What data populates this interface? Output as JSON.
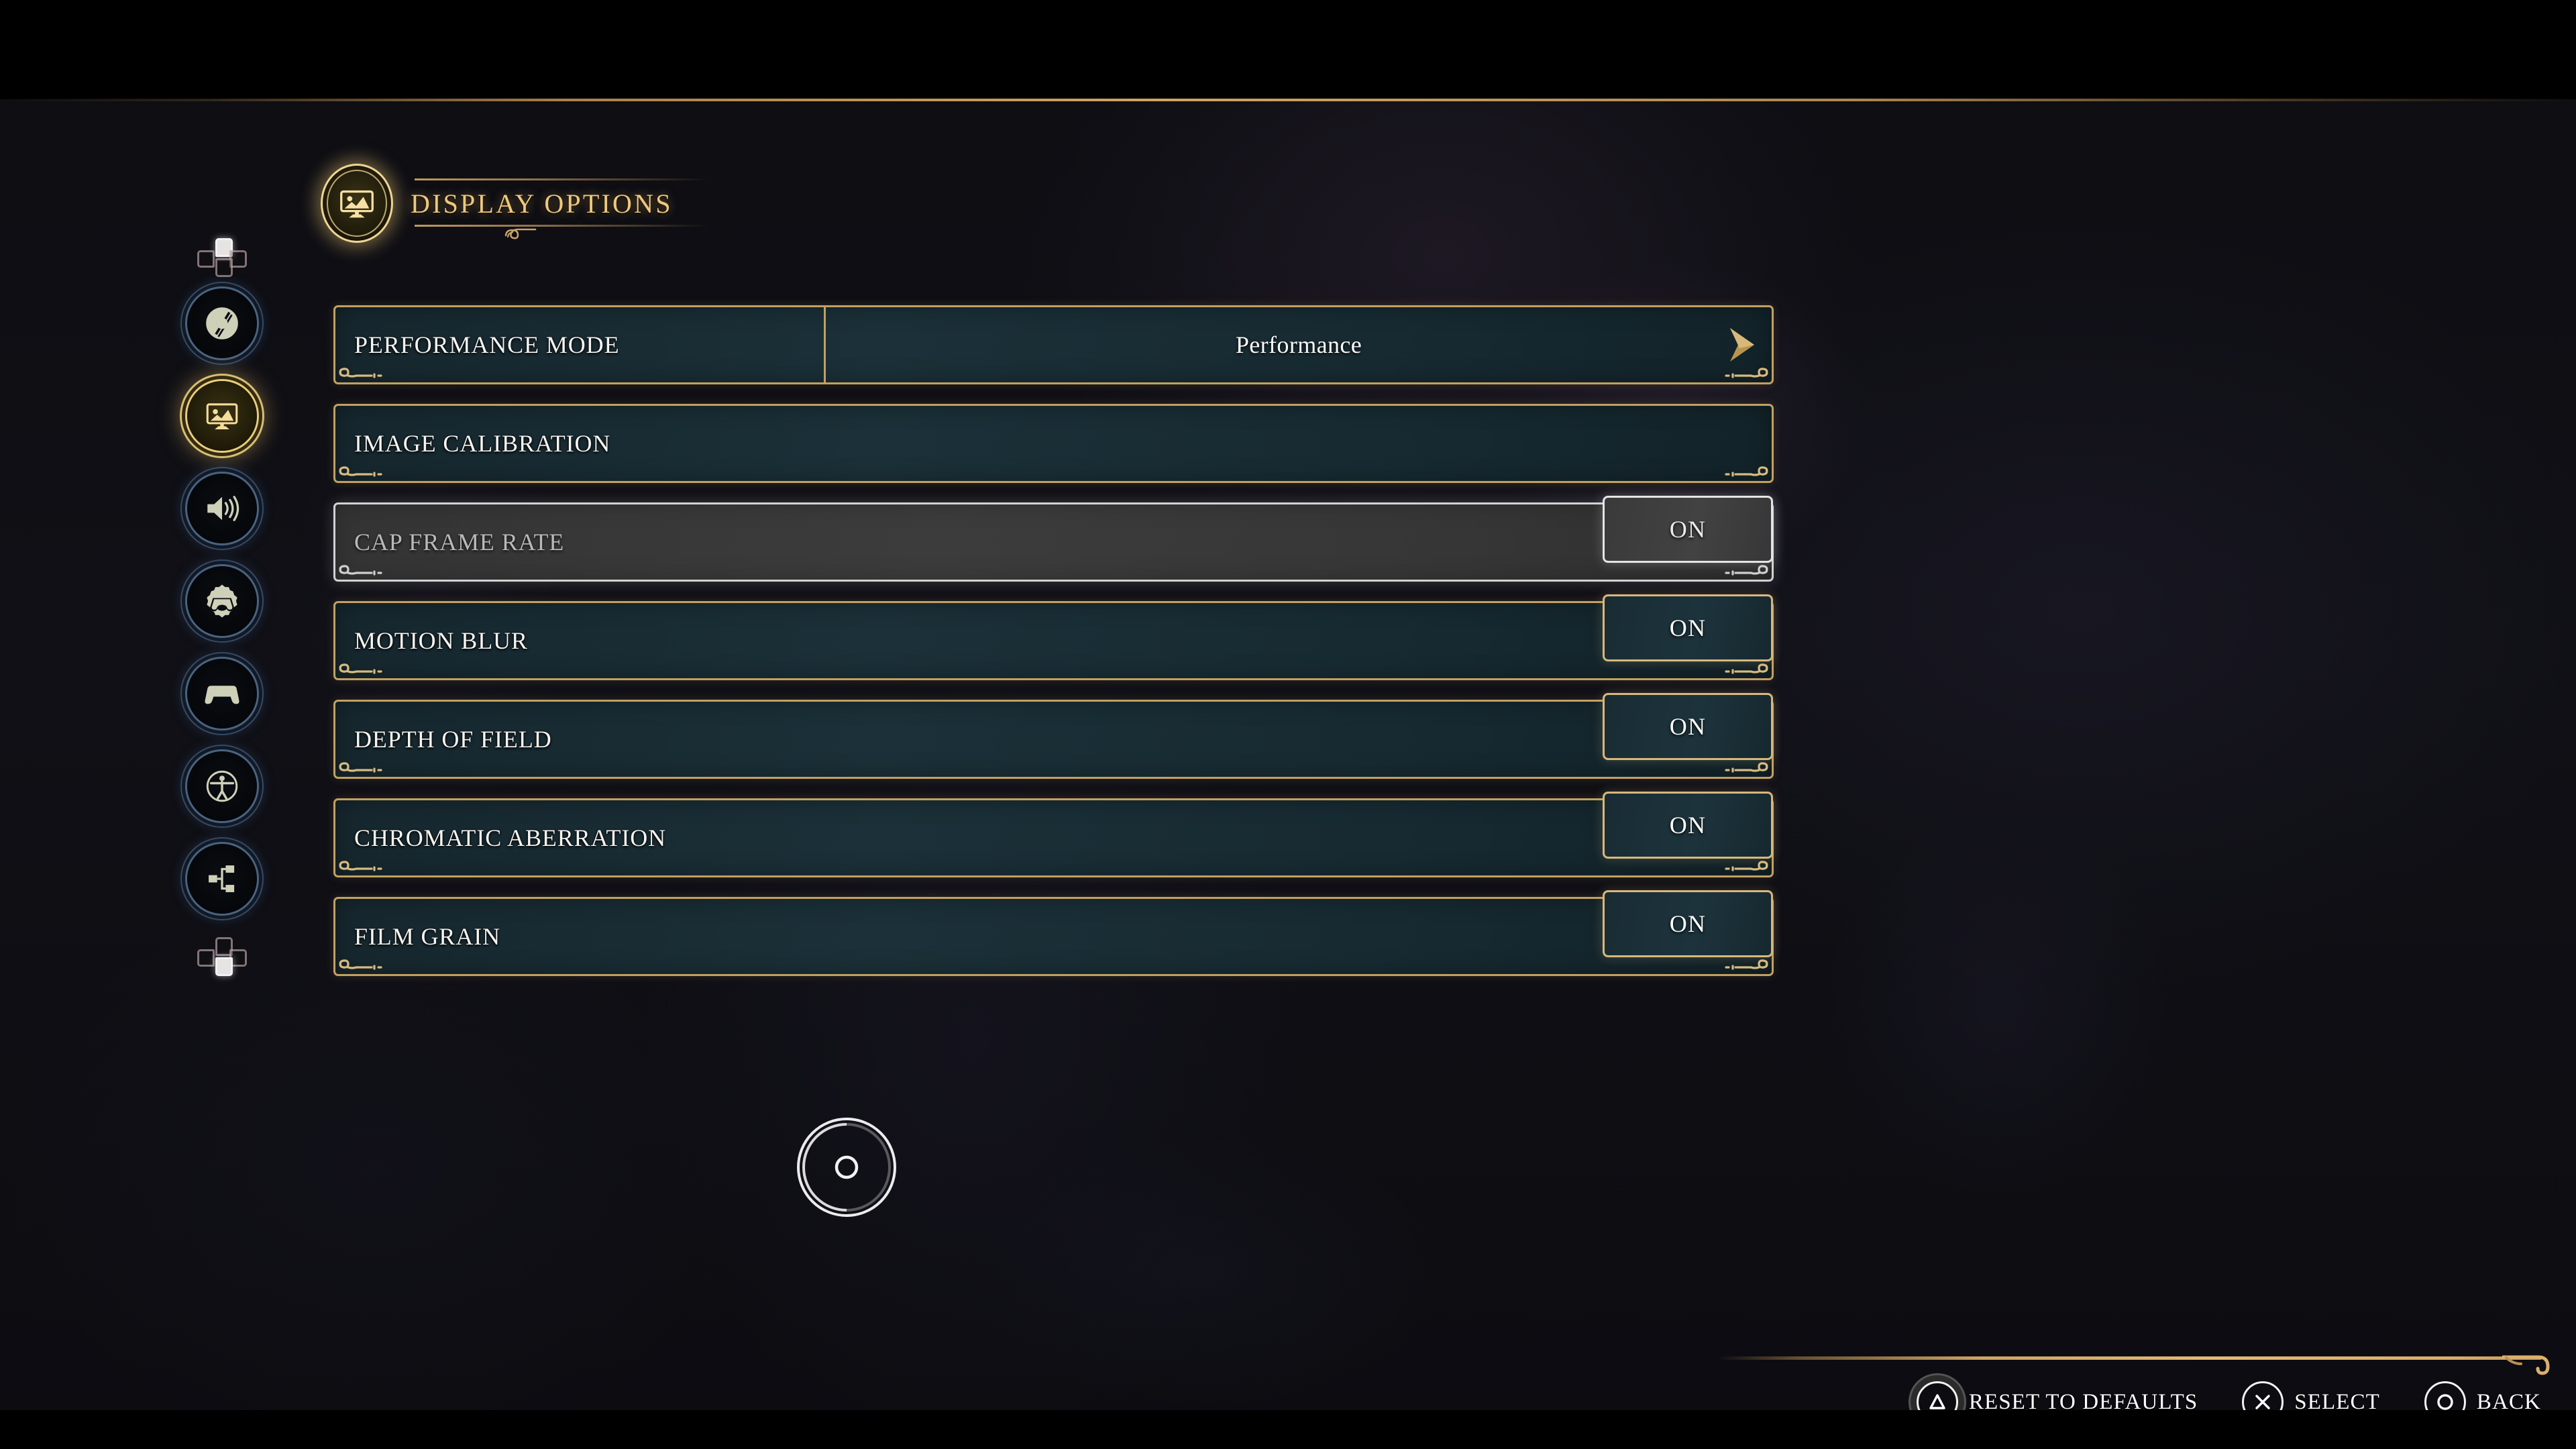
{
  "header": {
    "title": "DISPLAY OPTIONS",
    "icon": "display-monitor-icon"
  },
  "sidebar": {
    "dpad_up": "dpad-up-indicator",
    "dpad_down": "dpad-down-indicator",
    "items": [
      {
        "name": "game-options",
        "icon": "disc-icon",
        "active": false
      },
      {
        "name": "display-options",
        "icon": "display-monitor-icon",
        "active": true
      },
      {
        "name": "audio-options",
        "icon": "speaker-icon",
        "active": false
      },
      {
        "name": "controls-options",
        "icon": "gear-gamepad-icon",
        "active": false
      },
      {
        "name": "gamepad-options",
        "icon": "gamepad-icon",
        "active": false
      },
      {
        "name": "accessibility-options",
        "icon": "accessibility-icon",
        "active": false
      },
      {
        "name": "network-options",
        "icon": "network-icon",
        "active": false
      }
    ]
  },
  "options": [
    {
      "label": "PERFORMANCE MODE",
      "control": "cycler",
      "value": "Performance",
      "selected": false
    },
    {
      "label": "IMAGE CALIBRATION",
      "control": "none",
      "value": "",
      "selected": false
    },
    {
      "label": "CAP FRAME RATE",
      "control": "toggle",
      "value": "ON",
      "selected": true
    },
    {
      "label": "MOTION BLUR",
      "control": "toggle",
      "value": "ON",
      "selected": false
    },
    {
      "label": "DEPTH OF FIELD",
      "control": "toggle",
      "value": "ON",
      "selected": false
    },
    {
      "label": "CHROMATIC ABERRATION",
      "control": "toggle",
      "value": "ON",
      "selected": false
    },
    {
      "label": "FILM GRAIN",
      "control": "toggle",
      "value": "ON",
      "selected": false
    }
  ],
  "prompts": [
    {
      "button": "triangle",
      "label": "RESET TO DEFAULTS",
      "ringed": true
    },
    {
      "button": "cross",
      "label": "SELECT",
      "ringed": false
    },
    {
      "button": "circle",
      "label": "BACK",
      "ringed": false
    }
  ],
  "cursor": {
    "name": "pointer-reticle"
  },
  "colors": {
    "gold": "#c2a061",
    "gold_bright": "#f0d693",
    "title_gold": "#eec87e",
    "row_fill": "#1b3038",
    "selected_border": "#d2d2d2",
    "selected_fill": "#3c3c3c",
    "nav_glow_blue": "#5c82b0",
    "text_white": "#f6f5f2"
  }
}
